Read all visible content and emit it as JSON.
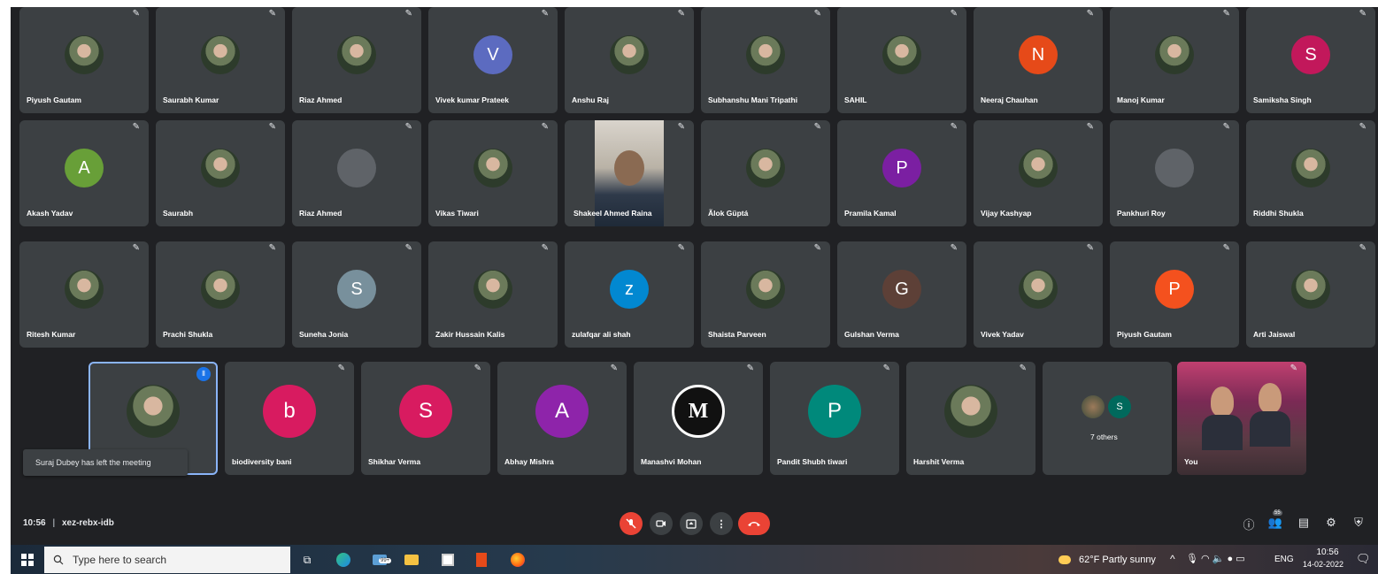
{
  "meeting": {
    "time": "10:56",
    "separator": "|",
    "code": "xez-rebx-idb",
    "toast": "Suraj Dubey has left the meeting"
  },
  "rows": [
    [
      {
        "name": "Piyush Gautam",
        "avatar": "photo"
      },
      {
        "name": "Saurabh Kumar",
        "avatar": "photo"
      },
      {
        "name": "Riaz Ahmed",
        "avatar": "photo"
      },
      {
        "name": "Vivek kumar Prateek",
        "avatar": "letter",
        "letter": "V",
        "color": "#5c6bc0"
      },
      {
        "name": "Anshu Raj",
        "avatar": "photo"
      },
      {
        "name": "Subhanshu Mani Tripathi",
        "avatar": "photo"
      },
      {
        "name": "SAHIL",
        "avatar": "photo"
      },
      {
        "name": "Neeraj Chauhan",
        "avatar": "letter",
        "letter": "N",
        "color": "#e64a19"
      },
      {
        "name": "Manoj Kumar",
        "avatar": "photo"
      },
      {
        "name": "Samiksha Singh",
        "avatar": "letter",
        "letter": "S",
        "color": "#c2185b"
      }
    ],
    [
      {
        "name": "Akash Yadav",
        "avatar": "letter",
        "letter": "A",
        "color": "#689f38"
      },
      {
        "name": "Saurabh",
        "avatar": "photo"
      },
      {
        "name": "Riaz Ahmed",
        "avatar": "ghost"
      },
      {
        "name": "Vikas Tiwari",
        "avatar": "photo"
      },
      {
        "name": "Shakeel Ahmed Raina",
        "avatar": "video"
      },
      {
        "name": "Ãlok Güptá",
        "avatar": "photo"
      },
      {
        "name": "Pramila Kamal",
        "avatar": "letter",
        "letter": "P",
        "color": "#7b1fa2"
      },
      {
        "name": "Vijay Kashyap",
        "avatar": "photo"
      },
      {
        "name": "Pankhuri Roy",
        "avatar": "ghost"
      },
      {
        "name": "Riddhi Shukla",
        "avatar": "photo"
      }
    ],
    [
      {
        "name": "Ritesh Kumar",
        "avatar": "photo"
      },
      {
        "name": "Prachi Shukla",
        "avatar": "photo"
      },
      {
        "name": "Suneha Jonia",
        "avatar": "letter",
        "letter": "S",
        "color": "#78909c"
      },
      {
        "name": "Zakir Hussain Kalis",
        "avatar": "photo"
      },
      {
        "name": "zulafqar ali shah",
        "avatar": "letter",
        "letter": "z",
        "color": "#0288d1"
      },
      {
        "name": "Shaista Parveen",
        "avatar": "photo"
      },
      {
        "name": "Gulshan Verma",
        "avatar": "letter",
        "letter": "G",
        "color": "#5d4037"
      },
      {
        "name": "Vivek Yadav",
        "avatar": "photo"
      },
      {
        "name": "Piyush Gautam",
        "avatar": "letter",
        "letter": "P",
        "color": "#f4511e"
      },
      {
        "name": "Arti Jaiswal",
        "avatar": "photo"
      }
    ],
    [
      {
        "name": "",
        "avatar": "photo",
        "speaking": true
      },
      {
        "name": "biodiversity bani",
        "avatar": "letter",
        "letter": "b",
        "color": "#d81b60"
      },
      {
        "name": "Shikhar Verma",
        "avatar": "letter",
        "letter": "S",
        "color": "#d81b60"
      },
      {
        "name": "Abhay Mishra",
        "avatar": "letter",
        "letter": "A",
        "color": "#8e24aa"
      },
      {
        "name": "Manashvi Mohan",
        "avatar": "letter",
        "letter": "M",
        "color": "#111111"
      },
      {
        "name": "Pandit Shubh tiwari",
        "avatar": "letter",
        "letter": "P",
        "color": "#00897b"
      },
      {
        "name": "Harshit Verma",
        "avatar": "photo"
      },
      {
        "name": "7 others",
        "avatar": "others"
      },
      {
        "name": "You",
        "avatar": "self"
      }
    ]
  ],
  "controls": {
    "mic_icon": "mic-off-icon",
    "camera_icon": "camera-icon",
    "present_icon": "present-icon",
    "more_icon": "more-icon",
    "end_icon": "end-call-icon",
    "people_count": "55"
  },
  "taskbar": {
    "search_placeholder": "Type here to search",
    "weather": "62°F  Partly sunny",
    "language": "ENG",
    "clock_time": "10:56",
    "clock_date": "14-02-2022",
    "notif_badge": "99+"
  },
  "others": {
    "letter": "S"
  }
}
